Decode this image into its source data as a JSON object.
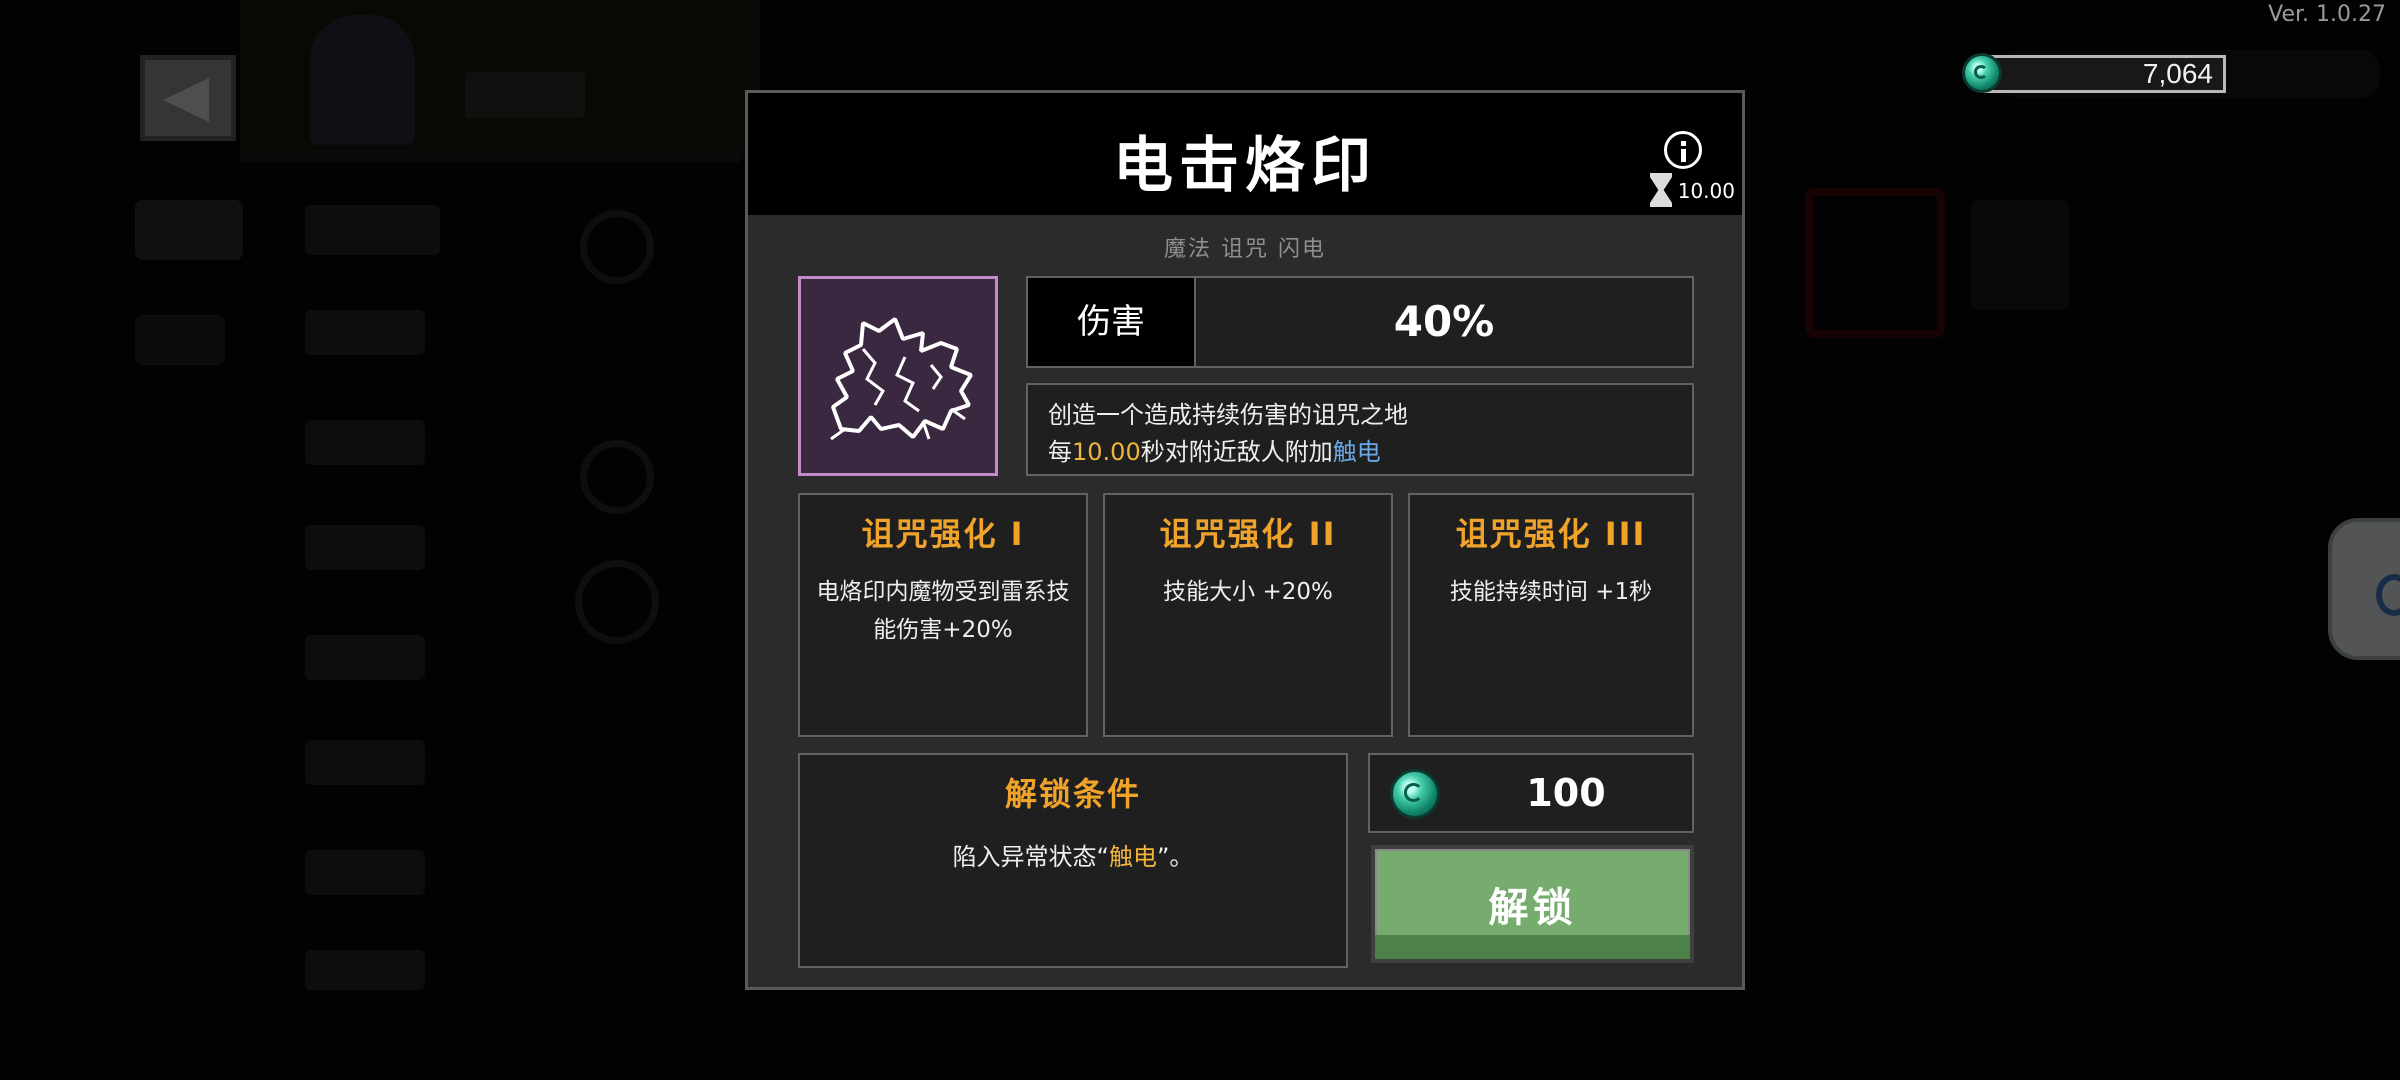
{
  "version": "Ver. 1.0.27",
  "hud": {
    "currency_value": "7,064",
    "currency_icon": "gem-icon"
  },
  "background": {
    "back_icon": "back-arrow-icon"
  },
  "modal": {
    "title": "电击烙印",
    "cooldown": "10.00",
    "tags": "魔法 诅咒 闪电",
    "skill_icon": "lightning-brand-icon",
    "stat": {
      "label": "伤害",
      "value": "40%"
    },
    "description": {
      "line1": "创造一个造成持续伤害的诅咒之地",
      "line2_before": "每",
      "line2_number": "10.00",
      "line2_middle": "秒对附近敌人附加",
      "line2_keyword": "触电"
    },
    "upgrades": [
      {
        "title": "诅咒强化 I",
        "desc": "电烙印内魔物受到雷系技能伤害+20%"
      },
      {
        "title": "诅咒强化 II",
        "desc": "技能大小 +20%"
      },
      {
        "title": "诅咒强化 III",
        "desc": "技能持续时间 +1秒"
      }
    ],
    "unlock_condition": {
      "title": "解锁条件",
      "before": "陷入异常状态“",
      "keyword": "触电",
      "after": "”。"
    },
    "cost": "100",
    "unlock_button": "解锁"
  },
  "colors": {
    "accent_orange": "#f0a32a",
    "highlight_blue": "#6aa8e8",
    "unlock_green": "#76ad6e",
    "icon_border": "#c58ac8"
  }
}
